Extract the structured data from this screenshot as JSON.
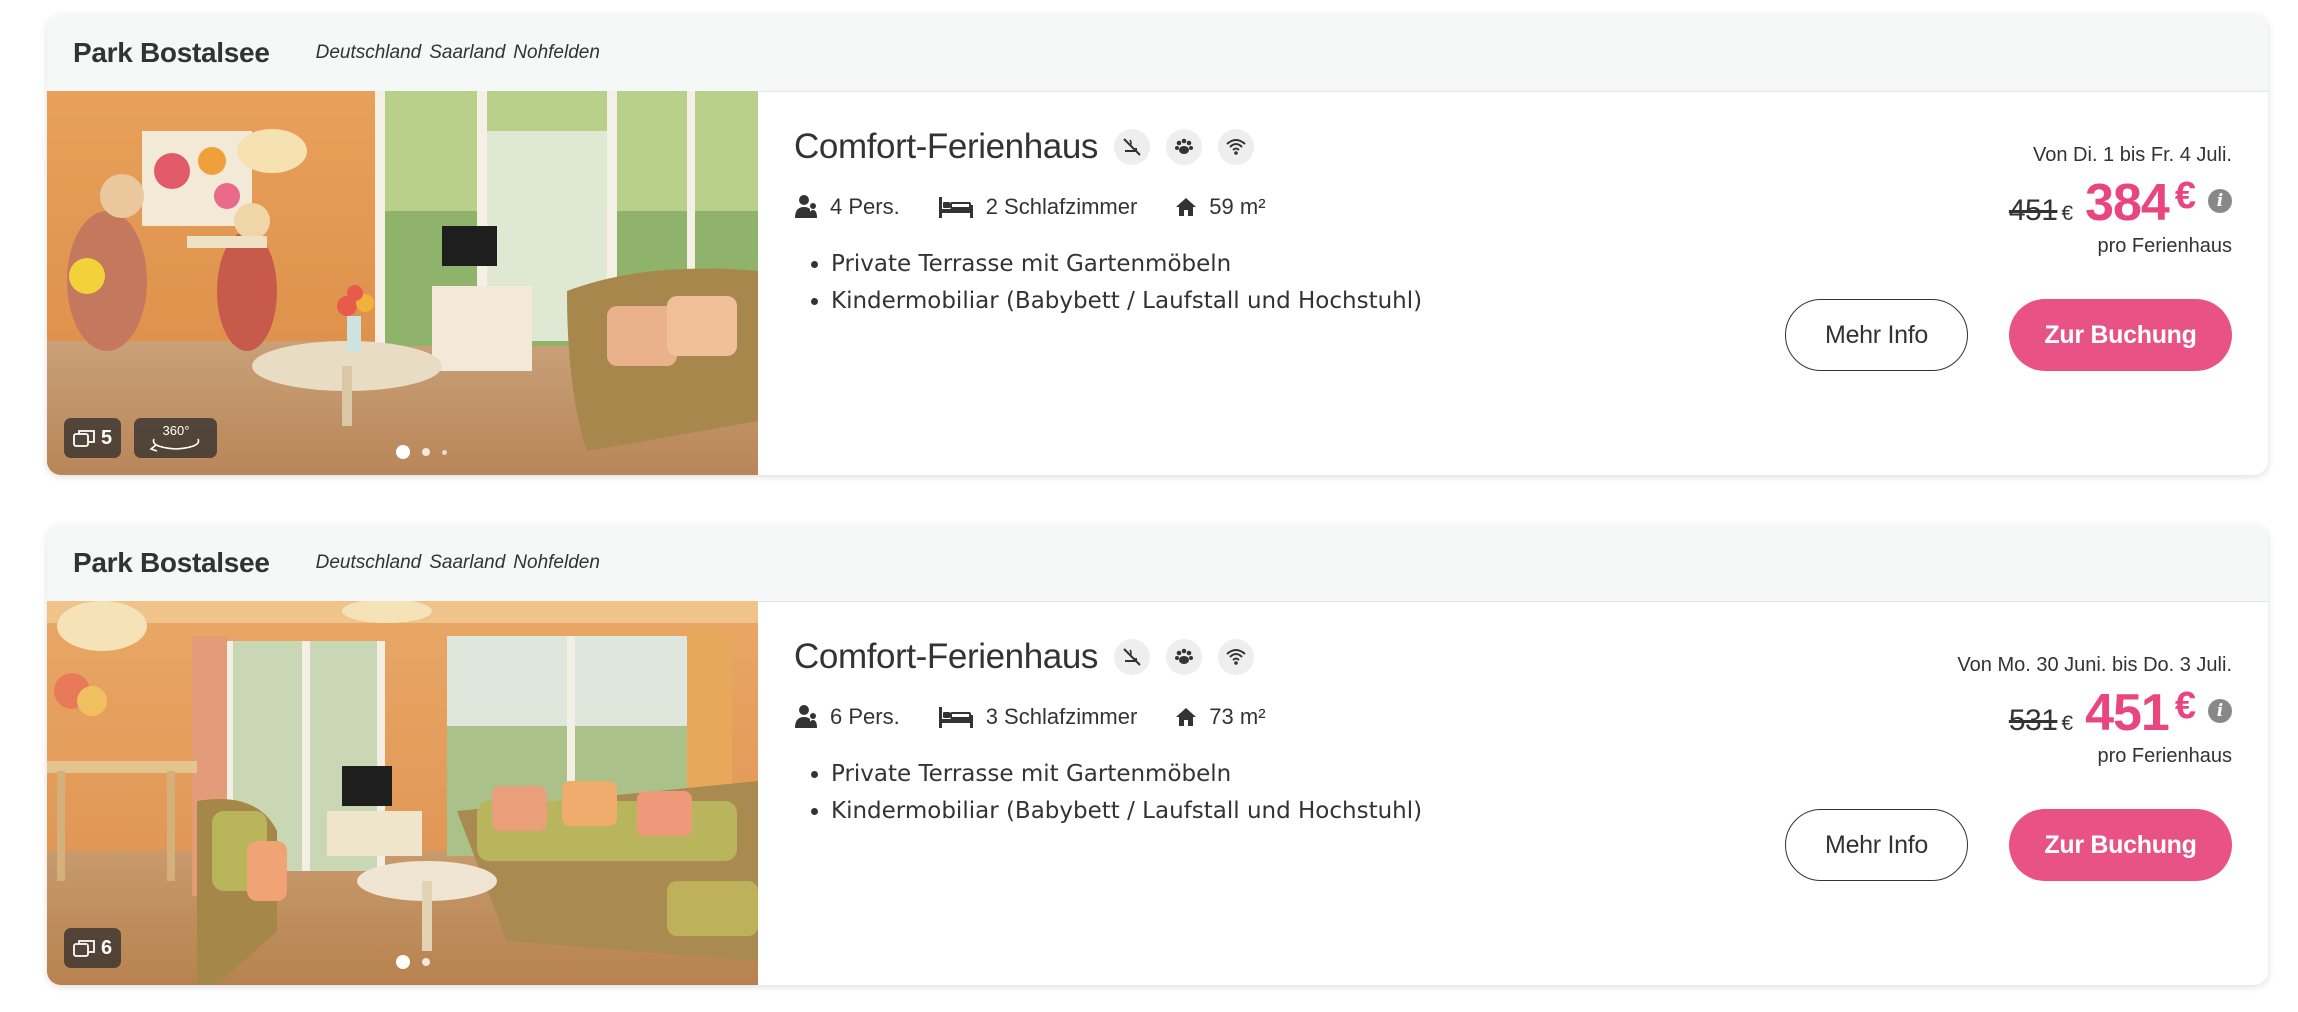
{
  "listings": [
    {
      "park_name": "Park Bostalsee",
      "location": [
        "Deutschland",
        "Saarland",
        "Nohfelden"
      ],
      "photo_count": "5",
      "has_360": true,
      "pano_label": "360°",
      "title": "Comfort-Ferienhaus",
      "amenities": [
        "no-smoking-icon",
        "pets-allowed-icon",
        "wifi-icon"
      ],
      "persons": "4 Pers.",
      "bedrooms": "2 Schlafzimmer",
      "area": "59 m²",
      "features": [
        "Private Terrasse mit Gartenmöbeln",
        "Kindermobiliar (Babybett / Laufstall und Hochstuhl)"
      ],
      "date_range": "Von Di. 1 bis Fr. 4 Juli.",
      "old_price": "451",
      "new_price": "384",
      "currency": "€",
      "per_unit": "pro Ferienhaus",
      "more_info_label": "Mehr Info",
      "book_label": "Zur Buchung"
    },
    {
      "park_name": "Park Bostalsee",
      "location": [
        "Deutschland",
        "Saarland",
        "Nohfelden"
      ],
      "photo_count": "6",
      "has_360": false,
      "title": "Comfort-Ferienhaus",
      "amenities": [
        "no-smoking-icon",
        "pets-allowed-icon",
        "wifi-icon"
      ],
      "persons": "6 Pers.",
      "bedrooms": "3 Schlafzimmer",
      "area": "73 m²",
      "features": [
        "Private Terrasse mit Gartenmöbeln",
        "Kindermobiliar (Babybett / Laufstall und Hochstuhl)"
      ],
      "date_range": "Von Mo. 30 Juni. bis Do. 3 Juli.",
      "old_price": "531",
      "new_price": "451",
      "currency": "€",
      "per_unit": "pro Ferienhaus",
      "more_info_label": "Mehr Info",
      "book_label": "Zur Buchung"
    }
  ],
  "colors": {
    "accent": "#e85285",
    "price": "#e8467d",
    "header_bg": "#f6f7f7"
  }
}
